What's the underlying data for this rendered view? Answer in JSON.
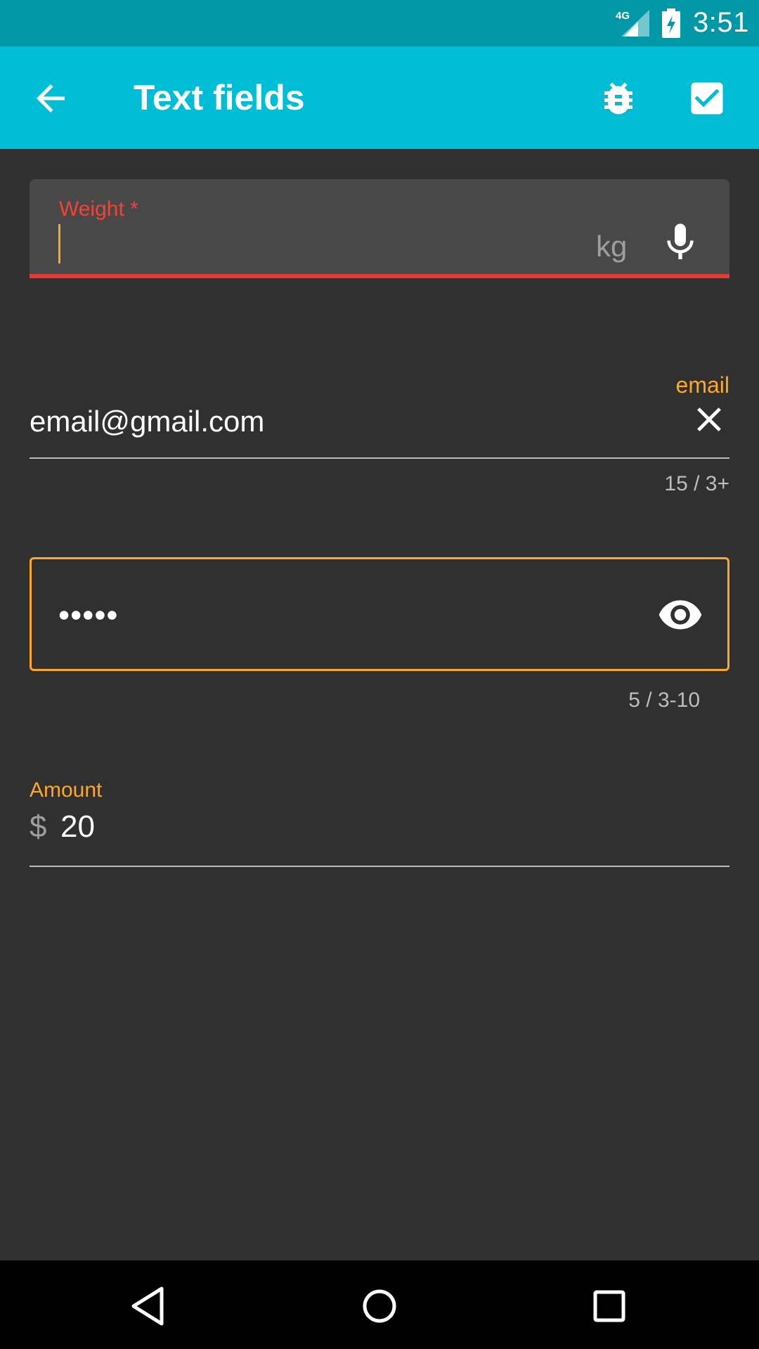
{
  "status_bar": {
    "network": "4G",
    "time": "3:51"
  },
  "app_bar": {
    "title": "Text fields",
    "icons": {
      "back": "arrow-back-icon",
      "bug": "bug-icon",
      "check": "checkbox-checked-icon"
    }
  },
  "weight_field": {
    "label": "Weight *",
    "value": "",
    "suffix": "kg",
    "icon": "mic-icon",
    "error_color": "#f44336"
  },
  "email_field": {
    "label": "email",
    "value": "email@gmail.com",
    "counter": "15 / 3+",
    "icon": "close-icon"
  },
  "password_field": {
    "masked_value": "•••••",
    "counter": "5 / 3-10",
    "icon": "eye-icon"
  },
  "amount_field": {
    "label": "Amount",
    "prefix": "$",
    "value": "20"
  },
  "colors": {
    "primary": "#00bcd4",
    "primary_dark": "#0097a7",
    "accent": "#ffa726",
    "error": "#f44336",
    "background": "#303030"
  },
  "nav_bar": {
    "icons": [
      "nav-back-icon",
      "nav-home-icon",
      "nav-recents-icon"
    ]
  }
}
